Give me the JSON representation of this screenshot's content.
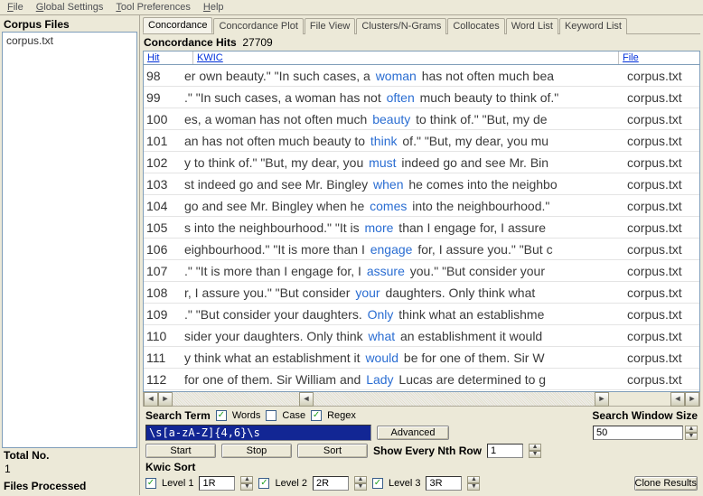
{
  "menu": {
    "file": "File",
    "global": "Global Settings",
    "tool": "Tool Preferences",
    "help": "Help"
  },
  "left": {
    "corpus_heading": "Corpus Files",
    "corpus_items": [
      "corpus.txt"
    ],
    "total_no_label": "Total No.",
    "total_no_value": "1",
    "files_processed_label": "Files Processed"
  },
  "tabs": {
    "concordance": "Concordance",
    "plot": "Concordance Plot",
    "fileview": "File View",
    "clusters": "Clusters/N-Grams",
    "collocates": "Collocates",
    "wordlist": "Word List",
    "keywords": "Keyword List"
  },
  "hits": {
    "label": "Concordance Hits",
    "count": "27709"
  },
  "gridh": {
    "hit": "Hit",
    "kwic": "KWIC",
    "file": "File"
  },
  "rows": [
    {
      "hit": "98",
      "pre": "er own beauty.\"  \"In such cases, a ",
      "kw": "woman",
      "post": " has not often much bea",
      "file": "corpus.txt"
    },
    {
      "hit": "99",
      "pre": ".\"  \"In such cases, a woman has not ",
      "kw": "often",
      "post": " much beauty to think of.\"",
      "file": "corpus.txt"
    },
    {
      "hit": "100",
      "pre": "es, a woman has not often much ",
      "kw": "beauty",
      "post": " to think of.\"  \"But, my de",
      "file": "corpus.txt"
    },
    {
      "hit": "101",
      "pre": "an has not often much beauty to ",
      "kw": "think",
      "post": " of.\"  \"But, my dear, you mu",
      "file": "corpus.txt"
    },
    {
      "hit": "102",
      "pre": "y to think of.\"  \"But, my dear, you ",
      "kw": "must",
      "post": " indeed go and see Mr. Bin",
      "file": "corpus.txt"
    },
    {
      "hit": "103",
      "pre": "st indeed go and see Mr. Bingley ",
      "kw": "when",
      "post": " he comes into the neighbo",
      "file": "corpus.txt"
    },
    {
      "hit": "104",
      "pre": "go and see Mr. Bingley when he ",
      "kw": "comes",
      "post": " into the neighbourhood.\"  ",
      "file": "corpus.txt"
    },
    {
      "hit": "105",
      "pre": "s into the neighbourhood.\"  \"It is ",
      "kw": "more",
      "post": " than I engage for, I assure",
      "file": "corpus.txt"
    },
    {
      "hit": "106",
      "pre": "eighbourhood.\"  \"It is more than I ",
      "kw": "engage",
      "post": " for, I assure you.\"  \"But c",
      "file": "corpus.txt"
    },
    {
      "hit": "107",
      "pre": ".\"  \"It is more than I engage for, I ",
      "kw": "assure",
      "post": " you.\"  \"But consider your",
      "file": "corpus.txt"
    },
    {
      "hit": "108",
      "pre": "r, I assure you.\"  \"But consider ",
      "kw": "your",
      "post": " daughters. Only think what",
      "file": "corpus.txt"
    },
    {
      "hit": "109",
      "pre": ".\"  \"But consider your daughters. ",
      "kw": "Only",
      "post": " think what an establishme",
      "file": "corpus.txt"
    },
    {
      "hit": "110",
      "pre": "sider your daughters. Only think ",
      "kw": "what",
      "post": " an establishment it would",
      "file": "corpus.txt"
    },
    {
      "hit": "111",
      "pre": "y think what an establishment it ",
      "kw": "would",
      "post": " be for one of them. Sir W",
      "file": "corpus.txt"
    },
    {
      "hit": "112",
      "pre": "for one of them. Sir William and ",
      "kw": "Lady",
      "post": " Lucas are determined to g",
      "file": "corpus.txt"
    }
  ],
  "controls": {
    "search_term_label": "Search Term",
    "words_label": "Words",
    "case_label": "Case",
    "regex_label": "Regex",
    "words_checked": "✓",
    "case_checked": "",
    "regex_checked": "✓",
    "search_value": "\\s[a-zA-Z]{4,6}\\s",
    "advanced": "Advanced",
    "search_window_label": "Search Window Size",
    "search_window_value": "50",
    "start": "Start",
    "stop": "Stop",
    "sort": "Sort",
    "show_every_label": "Show Every Nth Row",
    "show_every_value": "1",
    "kwic_sort_label": "Kwic Sort",
    "level1": "Level 1",
    "level2": "Level 2",
    "level3": "Level 3",
    "level1_val": "1R",
    "level2_val": "2R",
    "level3_val": "3R",
    "level_checked": "✓",
    "clone": "Clone Results"
  }
}
